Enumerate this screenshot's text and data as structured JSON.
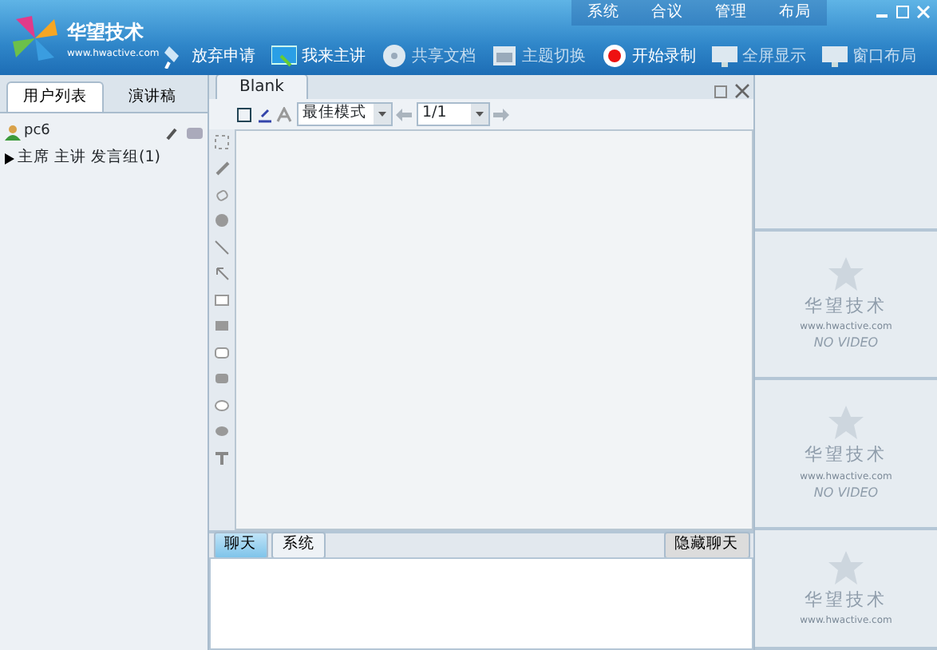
{
  "logo": {
    "name": "华望技术",
    "url": "www.hwactive.com"
  },
  "menu": [
    "系统",
    "合议",
    "管理",
    "布局"
  ],
  "toolbar": [
    {
      "label": "放弃申请",
      "disabled": false
    },
    {
      "label": "我来主讲",
      "disabled": false
    },
    {
      "label": "共享文档",
      "disabled": true
    },
    {
      "label": "主题切换",
      "disabled": true
    },
    {
      "label": "开始录制",
      "disabled": false
    },
    {
      "label": "全屏显示",
      "disabled": true
    },
    {
      "label": "窗口布局",
      "disabled": true
    }
  ],
  "left_tabs": [
    {
      "label": "用户列表",
      "selected": true
    },
    {
      "label": "演讲稿",
      "selected": false
    }
  ],
  "user": {
    "name": "pc6"
  },
  "tree": [
    {
      "label": "主席 主讲 发言组(1)",
      "expanded": false
    }
  ],
  "doc_tab": {
    "label": "Blank"
  },
  "doc_toolbar": {
    "mode": "最佳模式",
    "page": "1/1"
  },
  "chat_tabs": [
    {
      "label": "聊天",
      "selected": true
    },
    {
      "label": "系统",
      "selected": false
    }
  ],
  "chat_button": "隐藏聊天",
  "video_panels": [
    {
      "kind": "empty"
    },
    {
      "kind": "novideo",
      "brand": "华望技术",
      "url": "www.hwactive.com",
      "status": "NO VIDEO"
    },
    {
      "kind": "novideo",
      "brand": "华望技术",
      "url": "www.hwactive.com",
      "status": "NO VIDEO"
    },
    {
      "kind": "novideo",
      "brand": "华望技术",
      "url": "www.hwactive.com"
    }
  ]
}
